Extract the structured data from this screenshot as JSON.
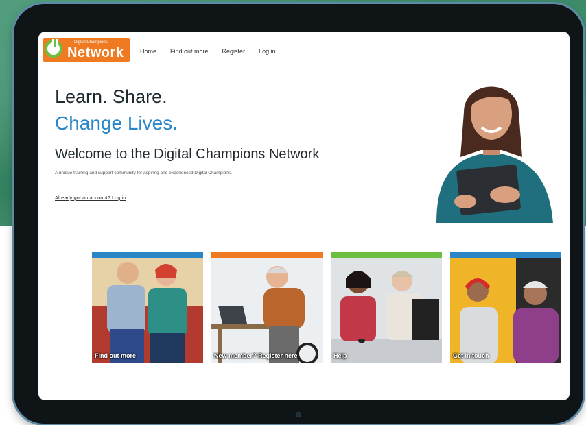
{
  "brand": {
    "small": "Digital Champions",
    "name": "Network",
    "orange": "#ef7a22",
    "green": "#6cbf3f"
  },
  "nav": {
    "items": [
      "Home",
      "Find out more",
      "Register",
      "Log in"
    ]
  },
  "hero": {
    "line1": "Learn. Share.",
    "line2": "Change Lives.",
    "welcome": "Welcome to the Digital Champions Network",
    "subtitle": "A unique training and support community for aspiring and experienced Digital Champions.",
    "login_link": "Already got an account? Log in",
    "accent": "#2a86c7"
  },
  "cards": [
    {
      "label": "Find out more",
      "bar_color": "#2a86c7"
    },
    {
      "label": "New member? Register here",
      "bar_color": "#ef7a22"
    },
    {
      "label": "Help",
      "bar_color": "#6cbf3f"
    },
    {
      "label": "Get in touch",
      "bar_color": "#2a86c7"
    }
  ]
}
